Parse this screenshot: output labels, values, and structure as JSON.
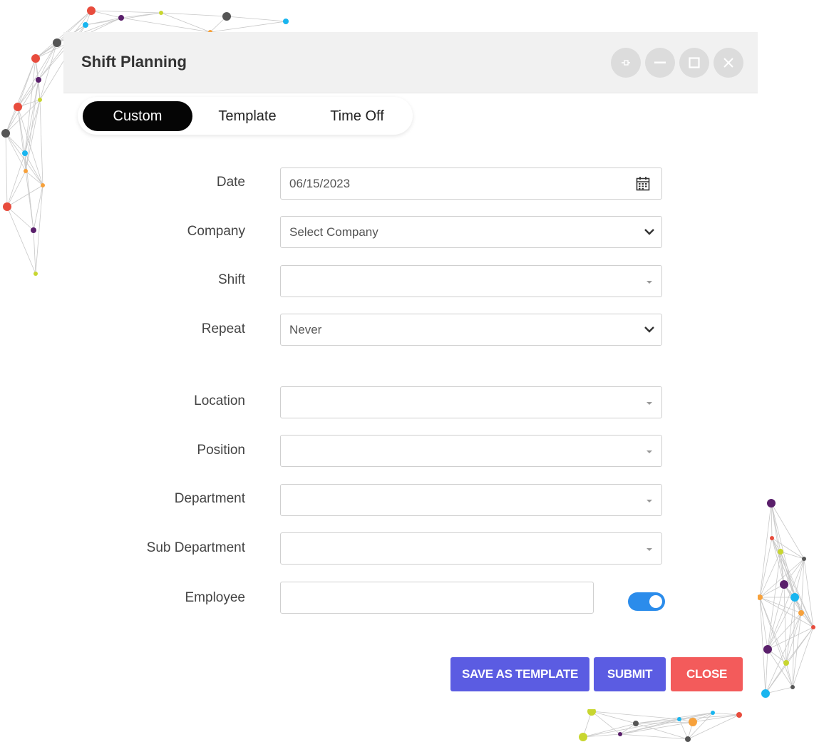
{
  "window": {
    "title": "Shift Planning",
    "controls": [
      "pin-icon",
      "minimize-icon",
      "maximize-icon",
      "close-icon"
    ]
  },
  "tabs": [
    {
      "label": "Custom",
      "active": true
    },
    {
      "label": "Template",
      "active": false
    },
    {
      "label": "Time Off",
      "active": false
    }
  ],
  "form": {
    "date": {
      "label": "Date",
      "value": "06/15/2023",
      "icon": "calendar-icon"
    },
    "company": {
      "label": "Company",
      "value": "Select Company"
    },
    "shift": {
      "label": "Shift",
      "value": ""
    },
    "repeat": {
      "label": "Repeat",
      "value": "Never"
    },
    "location": {
      "label": "Location",
      "value": ""
    },
    "position": {
      "label": "Position",
      "value": ""
    },
    "department": {
      "label": "Department",
      "value": ""
    },
    "sub_department": {
      "label": "Sub Department",
      "value": ""
    },
    "employee": {
      "label": "Employee",
      "value": "",
      "toggle_on": true
    }
  },
  "buttons": {
    "save_template": "SAVE AS TEMPLATE",
    "submit": "SUBMIT",
    "close": "CLOSE"
  },
  "colors": {
    "primary": "#5b5ce2",
    "danger": "#f35b5b",
    "toggle": "#2b8ceb",
    "active_tab": "#050505"
  }
}
